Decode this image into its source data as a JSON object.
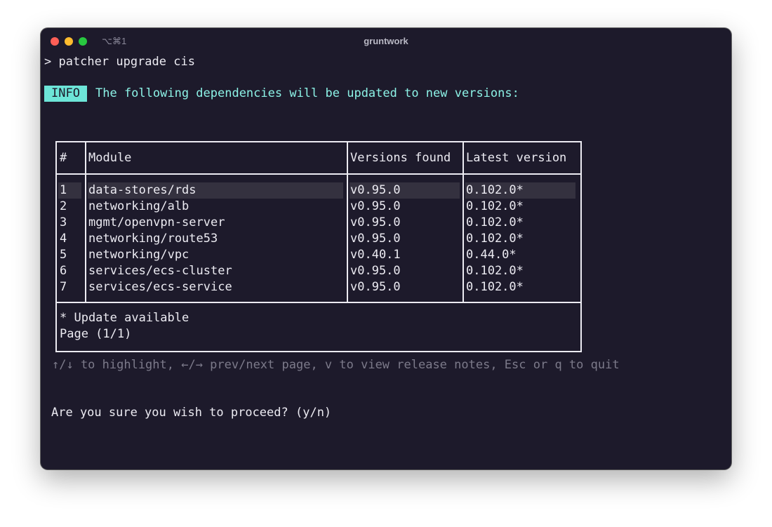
{
  "window": {
    "shortcut": "⌥⌘1",
    "title": "gruntwork"
  },
  "terminal": {
    "command": "> patcher upgrade cis",
    "info_badge": "INFO",
    "info_message": "The following dependencies will be updated to new versions:",
    "table": {
      "headers": {
        "num": "#",
        "module": "Module",
        "found": "Versions found",
        "latest": "Latest version"
      },
      "rows": [
        {
          "num": "1",
          "module": "data-stores/rds",
          "found": "v0.95.0",
          "latest": "0.102.0*"
        },
        {
          "num": "2",
          "module": "networking/alb",
          "found": "v0.95.0",
          "latest": "0.102.0*"
        },
        {
          "num": "3",
          "module": "mgmt/openvpn-server",
          "found": "v0.95.0",
          "latest": "0.102.0*"
        },
        {
          "num": "4",
          "module": "networking/route53",
          "found": "v0.95.0",
          "latest": "0.102.0*"
        },
        {
          "num": "5",
          "module": "networking/vpc",
          "found": "v0.40.1",
          "latest": "0.44.0*"
        },
        {
          "num": "6",
          "module": "services/ecs-cluster",
          "found": "v0.95.0",
          "latest": "0.102.0*"
        },
        {
          "num": "7",
          "module": "services/ecs-service",
          "found": "v0.95.0",
          "latest": "0.102.0*"
        }
      ],
      "highlighted_row": 1,
      "footer_note": "* Update available",
      "footer_page": "Page (1/1)"
    },
    "hint": "↑/↓ to highlight, ←/→ prev/next page, v to view release notes, Esc or q to quit",
    "prompt": "Are you sure you wish to proceed? (y/n)"
  }
}
